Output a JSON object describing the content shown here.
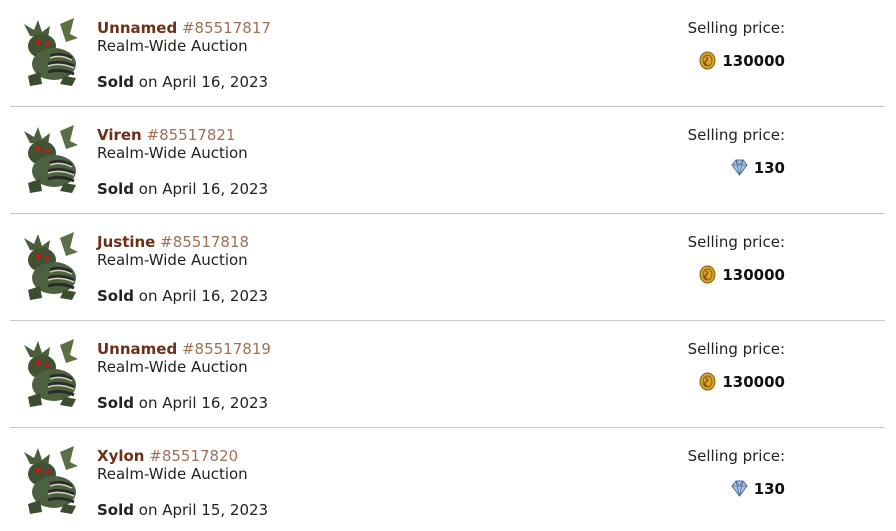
{
  "price_label": "Selling price:",
  "sold_word": "Sold",
  "sales": [
    {
      "name": "Unnamed",
      "id": "#85517817",
      "auction": "Realm-Wide Auction",
      "sold_on": "on April 16, 2023",
      "currency": "treasure-coin",
      "price": "130000"
    },
    {
      "name": "Viren",
      "id": "#85517821",
      "auction": "Realm-Wide Auction",
      "sold_on": "on April 16, 2023",
      "currency": "gem",
      "price": "130"
    },
    {
      "name": "Justine",
      "id": "#85517818",
      "auction": "Realm-Wide Auction",
      "sold_on": "on April 16, 2023",
      "currency": "treasure-coin",
      "price": "130000"
    },
    {
      "name": "Unnamed",
      "id": "#85517819",
      "auction": "Realm-Wide Auction",
      "sold_on": "on April 16, 2023",
      "currency": "treasure-coin",
      "price": "130000"
    },
    {
      "name": "Xylon",
      "id": "#85517820",
      "auction": "Realm-Wide Auction",
      "sold_on": "on April 15, 2023",
      "currency": "gem",
      "price": "130"
    }
  ],
  "colors": {
    "name": "#6e2f19",
    "id": "#a07055",
    "divider": "#c8c8c8",
    "coin": "#d9a42a",
    "gem": "#8fb3d9"
  }
}
